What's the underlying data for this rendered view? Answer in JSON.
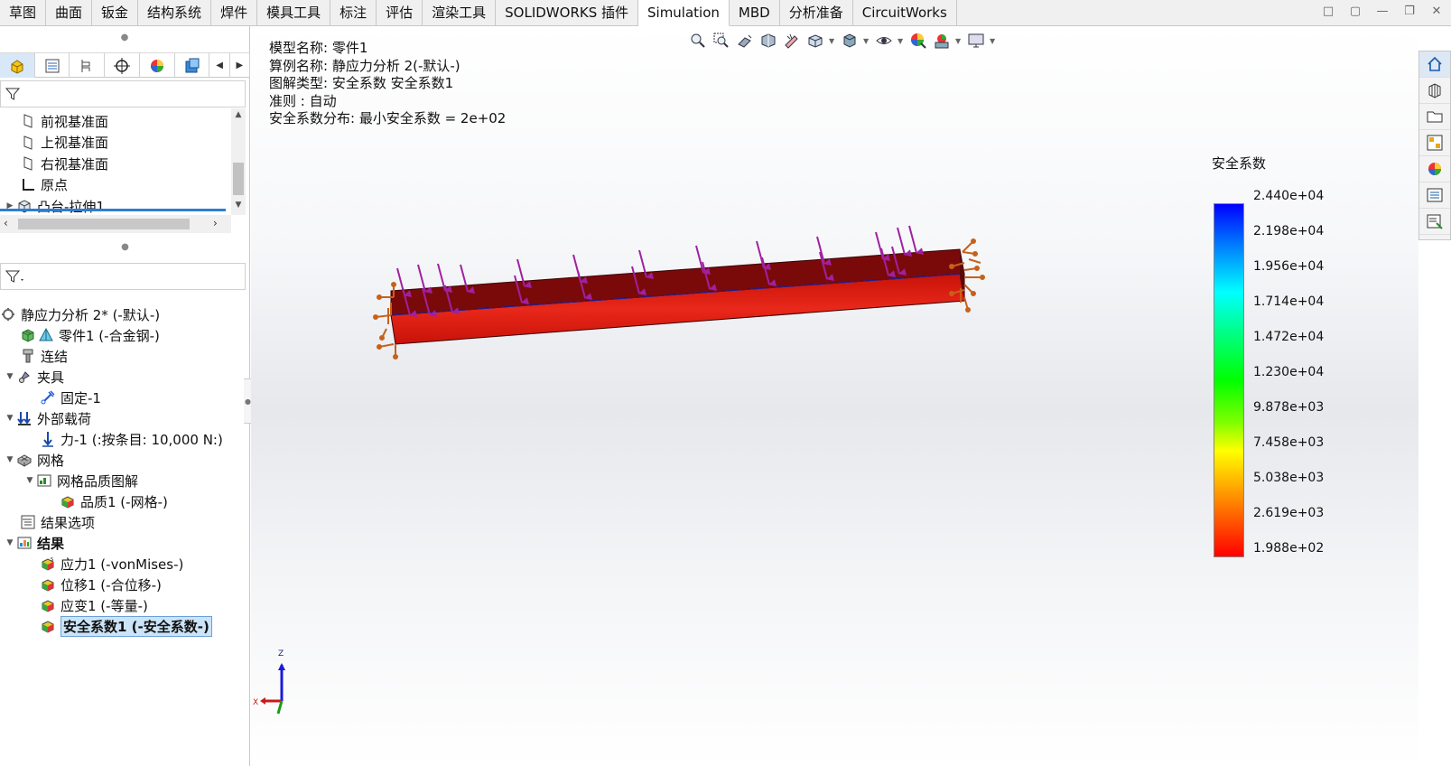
{
  "tabs": [
    {
      "label": "草图",
      "active": false
    },
    {
      "label": "曲面",
      "active": false
    },
    {
      "label": "钣金",
      "active": false
    },
    {
      "label": "结构系统",
      "active": false
    },
    {
      "label": "焊件",
      "active": false
    },
    {
      "label": "模具工具",
      "active": false
    },
    {
      "label": "标注",
      "active": false
    },
    {
      "label": "评估",
      "active": false
    },
    {
      "label": "渲染工具",
      "active": false
    },
    {
      "label": "SOLIDWORKS 插件",
      "active": false
    },
    {
      "label": "Simulation",
      "active": true
    },
    {
      "label": "MBD",
      "active": false
    },
    {
      "label": "分析准备",
      "active": false
    },
    {
      "label": "CircuitWorks",
      "active": false
    }
  ],
  "feature_tree": [
    {
      "label": "前视基准面",
      "icon": "plane-icon"
    },
    {
      "label": "上视基准面",
      "icon": "plane-icon"
    },
    {
      "label": "右视基准面",
      "icon": "plane-icon"
    },
    {
      "label": "原点",
      "icon": "origin-icon"
    },
    {
      "label": "凸台-拉伸1",
      "icon": "extrude-icon"
    }
  ],
  "sim_tree": {
    "study": "静应力分析 2* (-默认-)",
    "part": "零件1 (-合金钢-)",
    "connections": "连结",
    "fixtures": "夹具",
    "fixed": "固定-1",
    "loads": "外部载荷",
    "force": "力-1 (:按条目: 10,000 N:)",
    "mesh": "网格",
    "mesh_quality_plot": "网格品质图解",
    "quality": "品质1 (-网格-)",
    "result_options": "结果选项",
    "results": "结果",
    "stress": "应力1 (-vonMises-)",
    "displacement": "位移1 (-合位移-)",
    "strain": "应变1 (-等量-)",
    "fos": "安全系数1 (-安全系数-)"
  },
  "info": {
    "model_name": "模型名称: 零件1",
    "study_name": "算例名称: 静应力分析 2(-默认-)",
    "plot_type": "图解类型: 安全系数 安全系数1",
    "criterion": "准则 : 自动",
    "distribution": "安全系数分布: 最小安全系数 = 2e+02"
  },
  "legend": {
    "title": "安全系数",
    "labels": [
      "2.440e+04",
      "2.198e+04",
      "1.956e+04",
      "1.714e+04",
      "1.472e+04",
      "1.230e+04",
      "9.878e+03",
      "7.458e+03",
      "5.038e+03",
      "2.619e+03",
      "1.988e+02"
    ],
    "colors": {
      "max": "#0000ff",
      "mid": "#00ff00",
      "min": "#ff0000"
    }
  },
  "triad": {
    "z": "Z",
    "x": "X"
  },
  "colors": {
    "force_arrow": "#a020a0",
    "fixture_arrow": "#c8601a",
    "beam_top": "#7a0a0a",
    "beam_side": "#d81a10"
  },
  "taskpane_icons": [
    "home-icon",
    "resources-icon",
    "folder-icon",
    "view-palette-icon",
    "appearance-icon",
    "properties-icon",
    "custom-props-icon"
  ]
}
